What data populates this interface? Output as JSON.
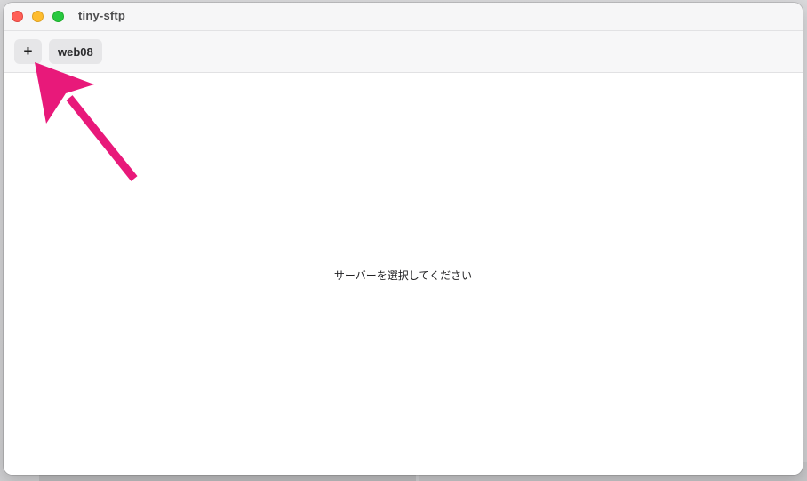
{
  "window": {
    "title": "tiny-sftp"
  },
  "toolbar": {
    "add_label": "+",
    "servers": [
      {
        "label": "web08"
      }
    ]
  },
  "main": {
    "empty_message": "サーバーを選択してください"
  },
  "annotation": {
    "arrow_color": "#e8197a",
    "points_to": "add-server-button"
  },
  "colors": {
    "close": "#ff5f57",
    "minimize": "#febc2e",
    "maximize": "#28c840"
  }
}
